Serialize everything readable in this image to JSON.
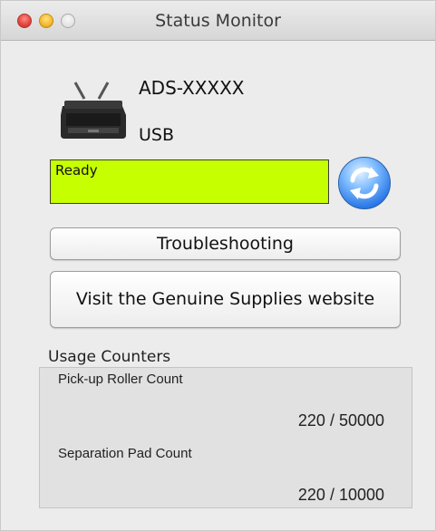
{
  "window": {
    "title": "Status Monitor"
  },
  "device": {
    "name": "ADS-XXXXX",
    "connection": "USB",
    "icon": "scanner-icon"
  },
  "status": {
    "text": "Ready",
    "color": "#c6ff00"
  },
  "buttons": {
    "troubleshooting": "Troubleshooting",
    "supplies": "Visit the Genuine Supplies website",
    "refresh_icon": "refresh-icon"
  },
  "usage": {
    "label": "Usage Counters",
    "counters": [
      {
        "name": "Pick-up Roller Count",
        "value": "220 / 50000"
      },
      {
        "name": "Separation Pad Count",
        "value": "220 / 10000"
      }
    ]
  }
}
